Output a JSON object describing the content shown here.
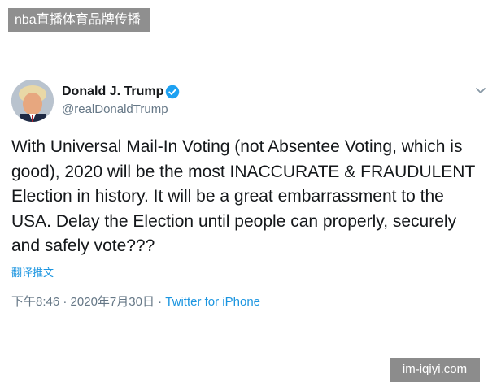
{
  "header_badge": {
    "text": "nba直播体育品牌传播"
  },
  "tweet": {
    "author": {
      "display_name": "Donald J. Trump",
      "handle": "@realDonaldTrump",
      "verified": true,
      "avatar_icon": "profile-photo",
      "verified_icon": "verified-badge-icon"
    },
    "text": "With Universal Mail-In Voting (not Absentee Voting, which is good), 2020 will be the most INACCURATE & FRAUDULENT Election in history. It will be a great embarrassment to the USA. Delay the Election until people can properly, securely and safely vote???",
    "translate_label": "翻译推文",
    "time": "下午8:46",
    "separator": "·",
    "date": "2020年7月30日",
    "source": "Twitter for iPhone"
  },
  "watermark": {
    "text": "im-iqiyi.com"
  },
  "colors": {
    "link_blue": "#1b95e0",
    "verified_blue": "#1da1f2",
    "muted_gray": "#657786",
    "text": "#14171a",
    "badge_gray": "#8f8f8f"
  }
}
